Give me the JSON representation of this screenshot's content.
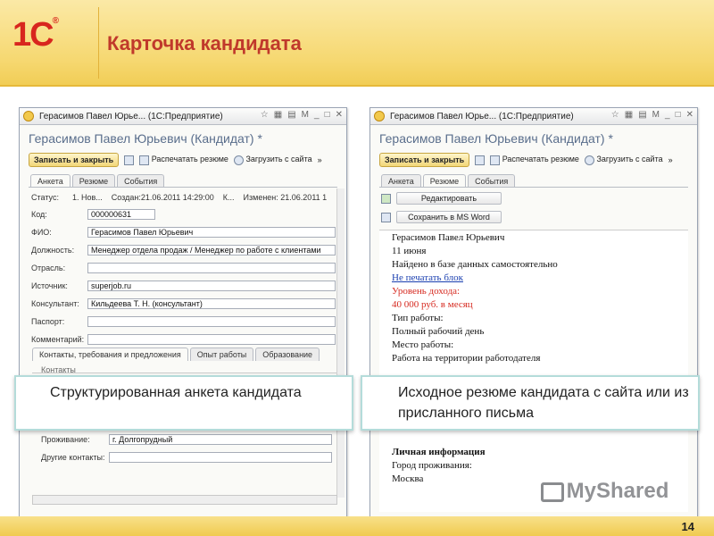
{
  "slide": {
    "logo_text": "1С",
    "logo_mark": "®",
    "title": "Карточка кандидата",
    "page_number": "14",
    "watermark": "MyShared"
  },
  "window_left": {
    "title": "Герасимов Павел Юрье...  (1С:Предприятие)",
    "form_title": "Герасимов Павел Юрьевич (Кандидат) *",
    "toolbar": {
      "save_close": "Записать и закрыть",
      "print_resume": "Распечатать резюме",
      "load_site": "Загрузить с сайта"
    },
    "tabs": [
      "Анкета",
      "Резюме",
      "События"
    ],
    "status_line": {
      "label": "Статус:",
      "value": "1. Нов...",
      "created": "Создан:21.06.2011 14:29:00",
      "k": "К...",
      "changed": "Изменен: 21.06.2011 1"
    },
    "fields": {
      "code_label": "Код:",
      "code_value": "000000631",
      "fio_label": "ФИО:",
      "fio_value": "Герасимов Павел Юрьевич",
      "position_label": "Должность:",
      "position_value": "Менеджер отдела продаж / Менеджер по работе с клиентами",
      "industry_label": "Отрасль:",
      "industry_value": "",
      "source_label": "Источник:",
      "source_value": "superjob.ru",
      "consultant_label": "Консультант:",
      "consultant_value": "Кильдеева Т. Н. (консультант)",
      "passport_label": "Паспорт:",
      "passport_value": "",
      "comment_label": "Комментарий:",
      "comment_value": "",
      "residence_label": "Проживание:",
      "residence_value": "г. Долгопрудный",
      "other_contacts_label": "Другие контакты:",
      "other_contacts_value": ""
    },
    "subtabs": [
      "Контакты, требования и предложения",
      "Опыт работы",
      "Образование"
    ],
    "group_label": "Контакты"
  },
  "window_right": {
    "title": "Герасимов Павел Юрье...  (1С:Предприятие)",
    "form_title": "Герасимов Павел Юрьевич (Кандидат) *",
    "toolbar": {
      "save_close": "Записать и закрыть",
      "print_resume": "Распечатать резюме",
      "load_site": "Загрузить с сайта"
    },
    "tabs": [
      "Анкета",
      "Резюме",
      "События"
    ],
    "edit_button": "Редактировать",
    "save_word_button": "Сохранить в MS Word",
    "resume_lines": {
      "l1": "Герасимов Павел Юрьевич",
      "l2": "11 июня",
      "l3": "Найдено в базе данных самостоятельно",
      "l4": "Не печатать блок",
      "l5": "Уровень дохода:",
      "l6": "40 000 руб. в месяц",
      "l7": "Тип работы:",
      "l8": "Полный рабочий день",
      "l9": "Место работы:",
      "l10": "Работа на территории работодателя",
      "l11": "Личная информация",
      "l12": "Город проживания:",
      "l13": "Москва"
    }
  },
  "callouts": {
    "left": "Структурированная анкета кандидата",
    "right": "Исходное резюме кандидата с сайта или из присланного письма"
  },
  "colors": {
    "accent_red": "#c0392b",
    "header_yellow": "#f6d871",
    "form_title_blue": "#5a6e8c"
  }
}
